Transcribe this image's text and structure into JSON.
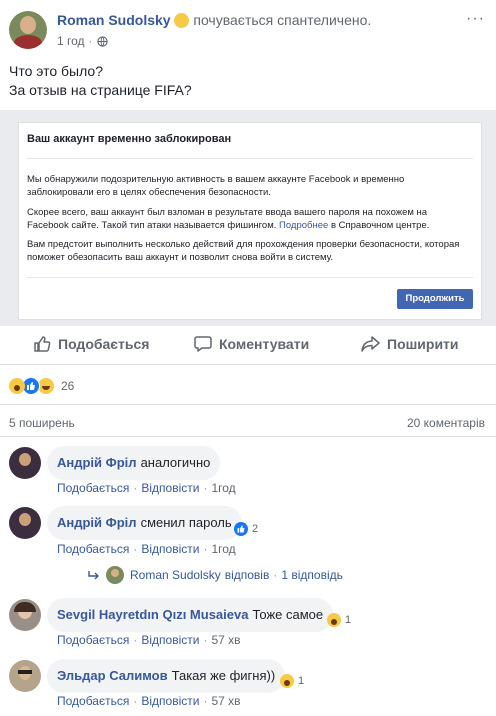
{
  "post": {
    "author": "Roman Sudolsky",
    "feeling": "почувається спантеличено.",
    "time": "1 год",
    "text_line1": "Что это было?",
    "text_line2": "За отзыв на странице FIFA?"
  },
  "embedded": {
    "title": "Ваш аккаунт временно заблокирован",
    "para1": "Мы обнаружили подозрительную активность в вашем аккаунте Facebook и временно заблокировали его в целях обеспечения безопасности.",
    "para2_pre": "Скорее всего, ваш аккаунт был взломан в результате ввода вашего пароля на похожем на Facebook сайте. Такой тип атаки называется фишингом. ",
    "para2_link": "Подробнее",
    "para2_post": " в Справочном центре.",
    "para3": "Вам предстоит выполнить несколько действий для прохождения проверки безопасности, которая поможет обезопасить ваш аккаунт и позволит снова войти в систему.",
    "button": "Продолжить"
  },
  "actions": {
    "like": "Подобається",
    "comment": "Коментувати",
    "share": "Поширити"
  },
  "reactions": {
    "count": "26"
  },
  "stats": {
    "shares": "5 поширень",
    "comments": "20 коментарів"
  },
  "comment_meta": {
    "like": "Подобається",
    "reply": "Відповісти"
  },
  "comments": [
    {
      "author": "Андрій Фріл",
      "text": "аналогично",
      "time": "1год"
    },
    {
      "author": "Андрій Фріл",
      "text": "сменил пароль",
      "time": "1год",
      "reactions": "2",
      "reply_author": "Roman Sudolsky",
      "reply_verb": "відповів",
      "reply_count": "1 відповідь"
    },
    {
      "author": "Sevgil Hayretdın Qızı Musaieva",
      "text": "Тоже самое",
      "time": "57 хв",
      "reactions": "1"
    },
    {
      "author": "Эльдар Салимов",
      "text": "Такая же фигня))",
      "time": "57 хв",
      "reactions": "1"
    }
  ],
  "colors": {
    "link": "#385898",
    "button": "#4267b2",
    "bubble": "#f2f3f5"
  }
}
